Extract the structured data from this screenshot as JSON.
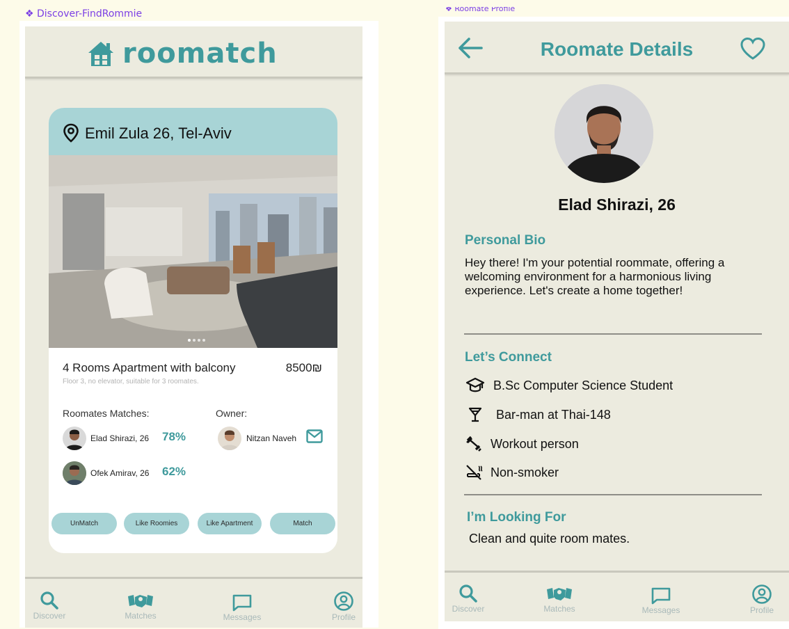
{
  "frames": {
    "left_label": "❖ Discover-FindRommie",
    "right_label": "❖ Roomate Profile"
  },
  "discover": {
    "logo": "roomatch",
    "card": {
      "address": "Emil Zula 26, Tel-Aviv",
      "title": "4 Rooms Apartment with balcony",
      "price": "8500₪",
      "subtitle": "Floor 3, no elevator, suitable for 3 roomates.",
      "roommates_label": "Roomates Matches:",
      "owner_label": "Owner:",
      "roommates": [
        {
          "name": "Elad Shirazi, 26",
          "match": "78%"
        },
        {
          "name": "Ofek Amirav, 26",
          "match": "62%"
        }
      ],
      "owner_name": "Nitzan Naveh",
      "carousel_pages": 4,
      "carousel_active": 1
    },
    "buttons": {
      "unmatch": "UnMatch",
      "like_roomies": "Like Roomies",
      "like_apartment": "Like Apartment",
      "match": "Match"
    }
  },
  "profile": {
    "title": "Roomate Details",
    "name": "Elad Shirazi, 26",
    "bio_heading": "Personal Bio",
    "bio": "Hey there! I'm your potential roommate, offering a welcoming environment for a harmonious living experience. Let's create a home together!",
    "connect_heading": "Let’s Connect",
    "connect_items": [
      {
        "icon": "graduation-cap-icon",
        "text": "B.Sc Computer Science Student"
      },
      {
        "icon": "cocktail-icon",
        "text": "Bar-man at Thai-148"
      },
      {
        "icon": "dumbbell-icon",
        "text": "Workout person"
      },
      {
        "icon": "no-smoking-icon",
        "text": "Non-smoker"
      }
    ],
    "looking_heading": "I’m Looking For",
    "looking_text": "Clean and quite room mates."
  },
  "nav": {
    "discover": "Discover",
    "matches": "Matches",
    "messages": "Messages",
    "profile": "Profile"
  },
  "colors": {
    "teal_accent": "#3f9a9c",
    "card_header": "#a8d4d6",
    "screen_bg": "#ecebdf",
    "canvas_bg": "#fdfbe9"
  }
}
